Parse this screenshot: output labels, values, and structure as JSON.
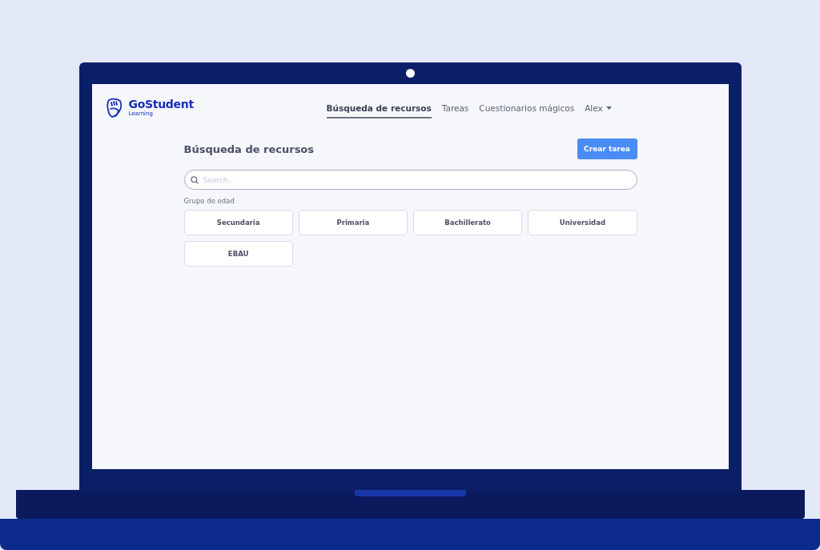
{
  "logo": {
    "name": "GoStudent",
    "subtitle": "Learning"
  },
  "nav": {
    "tabs": [
      {
        "label": "Búsqueda de recursos",
        "selected": true
      },
      {
        "label": "Tareas",
        "selected": false
      },
      {
        "label": "Cuestionarios mágicos",
        "selected": false
      }
    ],
    "user": "Alex"
  },
  "page": {
    "title": "Búsqueda de recursos",
    "create_button": "Crear tarea"
  },
  "search": {
    "placeholder": "Search..."
  },
  "filter": {
    "label": "Grupo de edad",
    "options": [
      "Secundaria",
      "Primaria",
      "Bachillerato",
      "Universidad",
      "EBAU"
    ]
  }
}
